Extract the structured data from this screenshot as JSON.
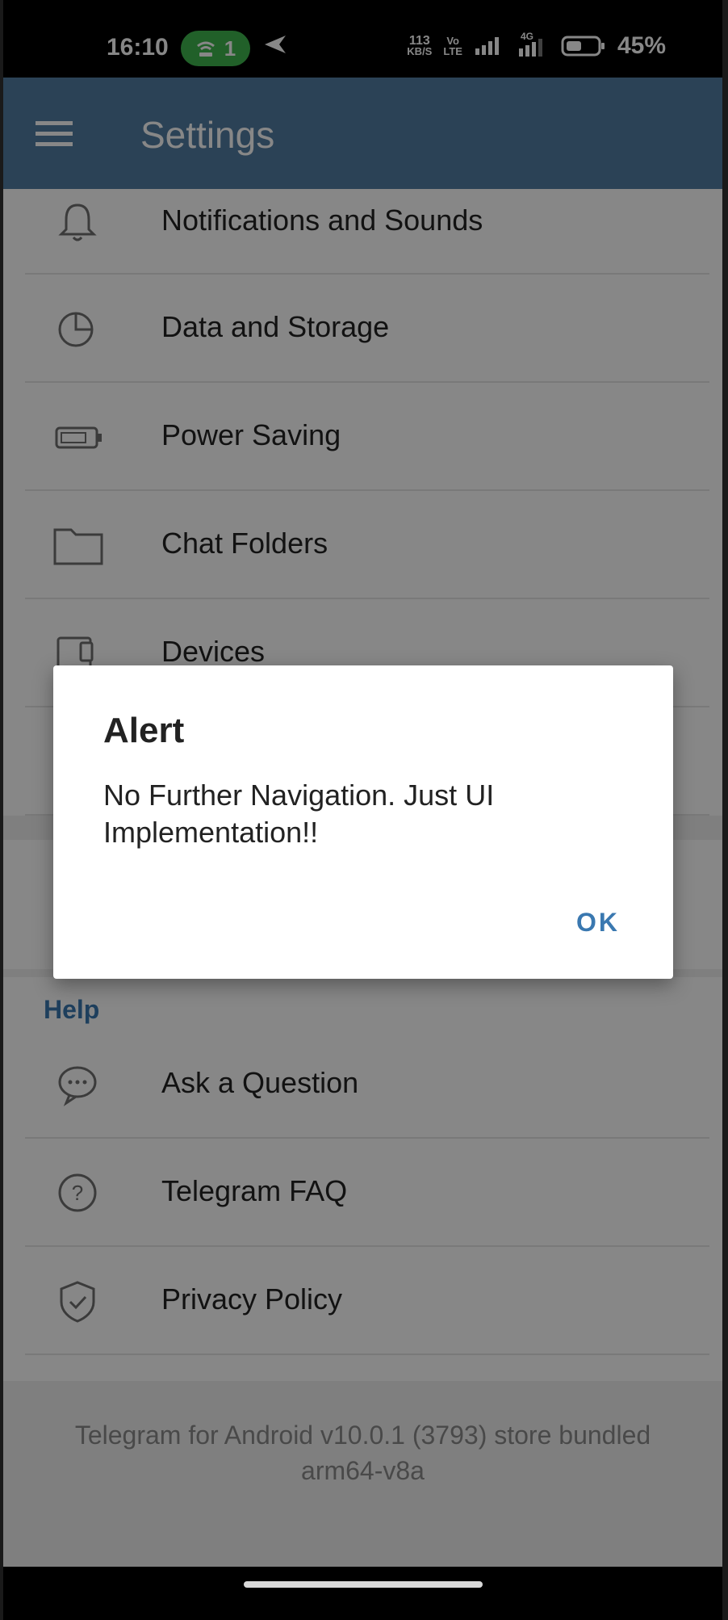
{
  "status_bar": {
    "time": "16:10",
    "hotspot_count": "1",
    "net_speed_value": "113",
    "net_speed_unit": "KB/S",
    "volte_top": "Vo",
    "volte_bottom": "LTE",
    "network": "4G",
    "battery_percent": "45%"
  },
  "app_bar": {
    "title": "Settings",
    "menu_icon": "hamburger-menu-icon",
    "color": "#517da2"
  },
  "settings_items": [
    {
      "label": "Notifications and Sounds",
      "icon": "bell-icon"
    },
    {
      "label": "Data and Storage",
      "icon": "pie-chart-icon"
    },
    {
      "label": "Power Saving",
      "icon": "battery-icon"
    },
    {
      "label": "Chat Folders",
      "icon": "folder-icon"
    },
    {
      "label": "Devices",
      "icon": "devices-icon"
    }
  ],
  "help_section": {
    "title": "Help",
    "items": [
      {
        "label": "Ask a Question",
        "icon": "chat-bubble-icon"
      },
      {
        "label": "Telegram FAQ",
        "icon": "question-circle-icon"
      },
      {
        "label": "Privacy Policy",
        "icon": "shield-check-icon"
      }
    ]
  },
  "footer": {
    "line1": "Telegram for Android v10.0.1 (3793) store bundled",
    "line2": "arm64-v8a"
  },
  "dialog": {
    "title": "Alert",
    "message": "No Further Navigation. Just UI Implementation!!",
    "ok_label": "OK",
    "accent": "#3a78b0"
  }
}
